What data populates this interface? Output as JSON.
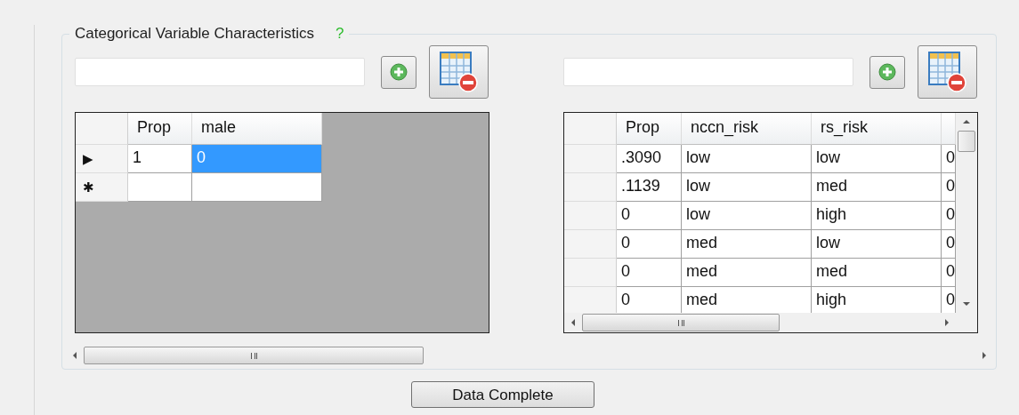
{
  "group": {
    "title": "Categorical Variable Characteristics",
    "help": "?"
  },
  "panels": [
    {
      "grid": {
        "scrollbars": false,
        "columns": [
          "Prop",
          "male"
        ],
        "rows": [
          {
            "marker": "▶",
            "cells": [
              {
                "text": "1",
                "selected": false
              },
              {
                "text": "0",
                "selected": true
              }
            ]
          },
          {
            "marker": "✱",
            "cells": [
              {
                "text": "",
                "selected": false
              },
              {
                "text": "",
                "selected": false
              }
            ]
          }
        ]
      }
    },
    {
      "grid": {
        "scrollbars": true,
        "columns": [
          "Prop",
          "nccn_risk",
          "rs_risk"
        ],
        "rows": [
          {
            "cells": [
              {
                "text": ".3090",
                "selected": false
              },
              {
                "text": "low",
                "selected": false
              },
              {
                "text": "low",
                "selected": false
              },
              {
                "text": "0",
                "selected": false
              }
            ]
          },
          {
            "cells": [
              {
                "text": ".1139",
                "selected": false
              },
              {
                "text": "low",
                "selected": false
              },
              {
                "text": "med",
                "selected": false
              },
              {
                "text": "0",
                "selected": false
              }
            ]
          },
          {
            "cells": [
              {
                "text": "0",
                "selected": false
              },
              {
                "text": "low",
                "selected": false
              },
              {
                "text": "high",
                "selected": false
              },
              {
                "text": "0",
                "selected": false
              }
            ]
          },
          {
            "cells": [
              {
                "text": "0",
                "selected": false
              },
              {
                "text": "med",
                "selected": false
              },
              {
                "text": "low",
                "selected": false
              },
              {
                "text": "0",
                "selected": false
              }
            ]
          },
          {
            "cells": [
              {
                "text": "0",
                "selected": false
              },
              {
                "text": "med",
                "selected": false
              },
              {
                "text": "med",
                "selected": false
              },
              {
                "text": "0",
                "selected": false
              }
            ]
          },
          {
            "cells": [
              {
                "text": "0",
                "selected": false
              },
              {
                "text": "med",
                "selected": false
              },
              {
                "text": "high",
                "selected": false
              },
              {
                "text": "0",
                "selected": false
              }
            ]
          }
        ]
      }
    }
  ],
  "button": "Data Complete"
}
